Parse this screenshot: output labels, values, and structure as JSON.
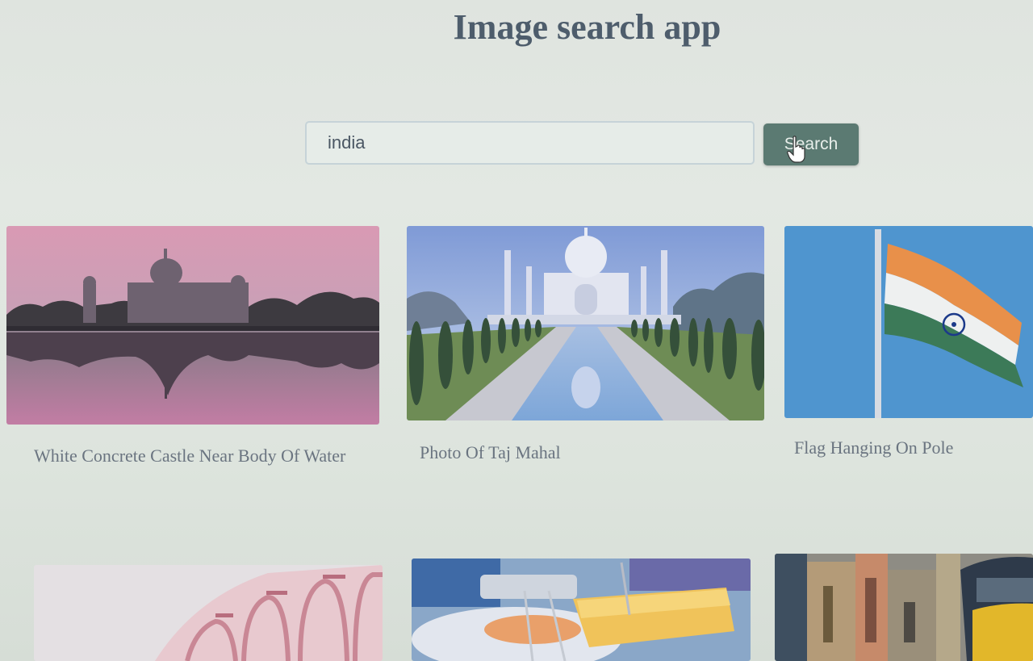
{
  "app": {
    "title": "Image search app"
  },
  "search": {
    "value": "india",
    "button_label": "Search"
  },
  "results": [
    {
      "title": "White Concrete Castle Near Body Of Water"
    },
    {
      "title": "Photo Of Taj Mahal"
    },
    {
      "title": "Flag Hanging On Pole"
    }
  ]
}
